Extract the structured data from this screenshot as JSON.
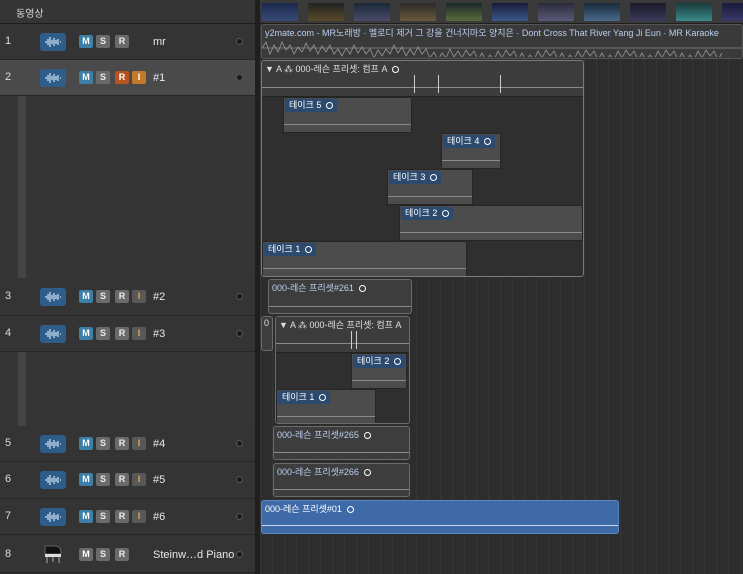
{
  "header": {
    "title": "동영상"
  },
  "tracks": [
    {
      "num": "1",
      "name": "mr",
      "rec": false,
      "input": false
    },
    {
      "num": "2",
      "name": "#1",
      "rec": true,
      "input": true
    },
    {
      "num": "3",
      "name": "#2",
      "rec": false,
      "input": true
    },
    {
      "num": "4",
      "name": "#3",
      "rec": false,
      "input": true
    },
    {
      "num": "5",
      "name": "#4",
      "rec": false,
      "input": true
    },
    {
      "num": "6",
      "name": "#5",
      "rec": false,
      "input": true
    },
    {
      "num": "7",
      "name": "#6",
      "rec": false,
      "input": true
    },
    {
      "num": "8",
      "name": "Steinw…d Piano",
      "rec": false,
      "input": false
    }
  ],
  "buttons": {
    "mute": "M",
    "solo": "S",
    "record": "R",
    "input": "I"
  },
  "regions": {
    "mr": "y2mate.com - MR노래방 · 멜로디 제거 그 강을 건너지마오  양지은 · Dont Cross That River  Yang Ji Eun · MR Karaoke",
    "t2_comp": "000-레슨 프리셋: 컴프 A",
    "t2_takes": [
      "테이크 5",
      "테이크 4",
      "테이크 3",
      "테이크 2",
      "테이크 1"
    ],
    "t3": "000-레슨 프리셋#261",
    "t4_prefix": "0",
    "t4_comp": "000-레슨 프리셋: 컴프 A",
    "t4_takes": [
      "테이크 2",
      "테이크 1"
    ],
    "t5": "000-레슨 프리셋#265",
    "t6": "000-레슨 프리셋#266",
    "t7": "000-레슨 프리셋#01",
    "letter_a": "A"
  },
  "colors": {
    "accent": "#3d7fa6",
    "record": "#b7531f",
    "selected_region": "#3e6aa8"
  }
}
